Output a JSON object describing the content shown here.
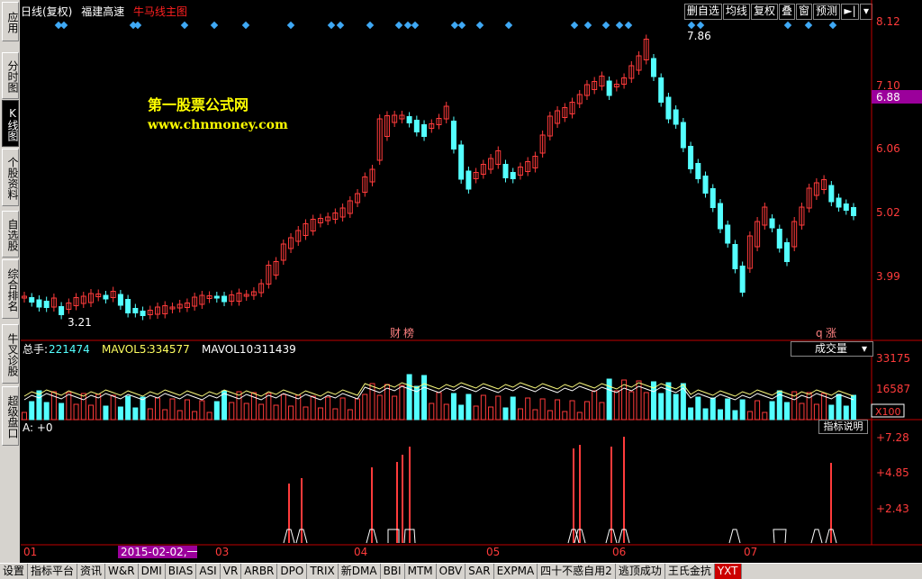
{
  "sidebar": {
    "items": [
      "应用",
      "分时图",
      "K线图",
      "个股资料",
      "自选股",
      "综合排名",
      "牛叉诊股",
      "超级盘口"
    ]
  },
  "header": {
    "period": "日线(复权)",
    "stock": "福建高速",
    "main_indicator": "牛马线主图"
  },
  "toolbar": {
    "buttons": [
      "删自选",
      "均线",
      "复权",
      "叠",
      "窗",
      "预测"
    ]
  },
  "annotations": {
    "high": "7.86",
    "low": "3.21",
    "event1": "财",
    "event2": "榜",
    "event3": "q",
    "event4": "涨",
    "current_price": "6.88"
  },
  "price_axis": [
    "8.12",
    "7.10",
    "6.06",
    "5.02",
    "3.99"
  ],
  "volume": {
    "label": "总手:",
    "value": "221474",
    "mavol5_label": "MAVOL5:",
    "mavol5": "334577",
    "mavol10_label": "MAVOL10:",
    "mavol10": "311439",
    "select": "成交量",
    "axis": [
      "33175",
      "16587",
      "X100"
    ]
  },
  "indicator": {
    "label": "A: +0",
    "button": "指标说明",
    "axis": [
      "+7.28",
      "+4.85",
      "+2.43"
    ]
  },
  "date_axis": {
    "labels": [
      "01",
      "03",
      "04",
      "05",
      "06",
      "07"
    ],
    "cursor_date": "2015-02-02,一"
  },
  "watermark": {
    "line1": "第一股票公式网",
    "line2": "www.chnmoney.com"
  },
  "taskbar": [
    "设置",
    "指标平台",
    "资讯",
    "W&R",
    "DMI",
    "BIAS",
    "ASI",
    "VR",
    "ARBR",
    "DPO",
    "TRIX",
    "新DMA",
    "BBI",
    "MTM",
    "OBV",
    "SAR",
    "EXPMA",
    "四十不惑自用2",
    "逃顶成功",
    "王氏金抗",
    "YXT"
  ],
  "colors": {
    "up": "#ff3b3b",
    "down": "#54ffff",
    "diamond": "#3fa9f5",
    "axis": "#c00000",
    "text": "#ffffff",
    "highlight": "#ff00ff"
  },
  "chart_data": {
    "type": "candlestick",
    "note_values": {
      "max": "7.86",
      "min": "3.21"
    }
  }
}
